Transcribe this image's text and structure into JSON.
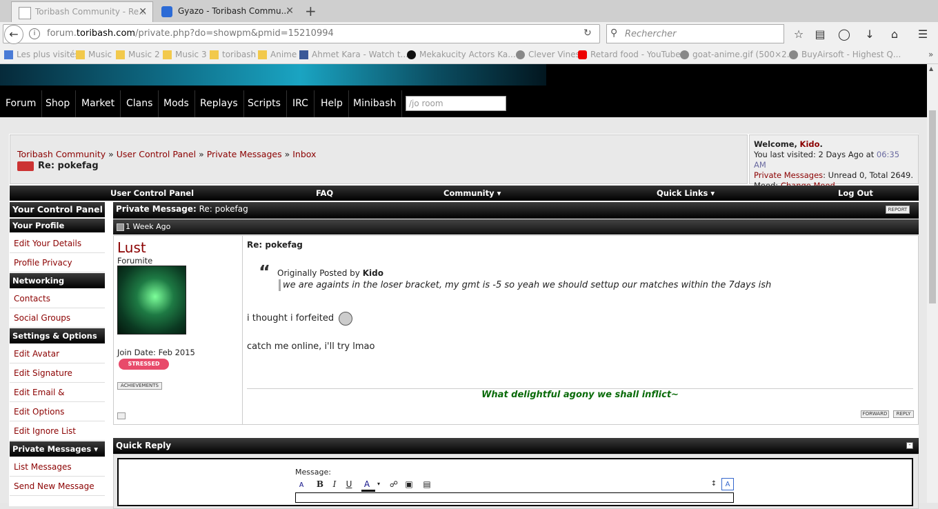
{
  "browser": {
    "tabs": [
      {
        "title": "Toribash Community - Re...",
        "active": true
      },
      {
        "title": "Gyazo - Toribash Commu...",
        "active": false
      }
    ],
    "new_tab": "+",
    "close_glyph": "✕",
    "url_prefix": "forum.",
    "url_domain": "toribash.com",
    "url_path": "/private.php?do=showpm&pmid=15210994",
    "search_placeholder": "Rechercher",
    "bookmarks": [
      "Les plus visités",
      "Music",
      "Music 2",
      "Music 3",
      "toribash",
      "Anime",
      "Ahmet Kara - Watch t...",
      "Mekakucity Actors Ka...",
      "Clever Vines",
      "Retard food - YouTube",
      "goat-anime.gif (500×2...",
      "BuyAirsoft - Highest Q..."
    ]
  },
  "topnav": {
    "items": [
      "Forum",
      "Shop",
      "Market",
      "Clans",
      "Mods",
      "Replays",
      "Scripts",
      "IRC",
      "Help",
      "Minibash"
    ],
    "room_placeholder": "/jo room"
  },
  "breadcrumb": {
    "items": [
      "Toribash Community",
      "User Control Panel",
      "Private Messages",
      "Inbox"
    ],
    "separator": "»",
    "current": "Re: pokefag"
  },
  "welcome": {
    "greeting": "Welcome,",
    "username": "Kido",
    "last_visited_label": "You last visited: 2 Days Ago at",
    "last_visited_time": "06:35 AM",
    "pm_label": "Private Messages",
    "pm_counts": ": Unread 0, Total 2649.",
    "mood_label": "Mood:",
    "mood_link": "Change Mood"
  },
  "ucpbar": {
    "ucp": "User Control Panel",
    "faq": "FAQ",
    "community": "Community",
    "quick_links": "Quick Links",
    "logout": "Log Out"
  },
  "sidebar": {
    "title": "Your Control Panel",
    "sections": [
      {
        "heading": "Your Profile",
        "items": [
          "Edit Your Details",
          "Profile Privacy"
        ]
      },
      {
        "heading": "Networking",
        "items": [
          "Contacts",
          "Social Groups"
        ]
      },
      {
        "heading": "Settings & Options",
        "items": [
          "Edit Avatar",
          "Edit Signature",
          "Edit Email & Password",
          "Edit Options",
          "Edit Ignore List"
        ]
      },
      {
        "heading": "Private Messages",
        "items": [
          "List Messages",
          "Send New Message"
        ]
      }
    ]
  },
  "pm": {
    "header_label": "Private Message:",
    "header_title": "Re: pokefag",
    "report": "REPORT",
    "date": "1 Week Ago",
    "author": "Lust",
    "author_title": "Forumite",
    "join_date": "Join Date: Feb 2015",
    "mood_badge": "STRESSED",
    "achievements": "ACHIEVEMENTS",
    "subject": "Re: pokefag",
    "quote_prefix": "Originally Posted by",
    "quote_author": "Kido",
    "quote_text": "we are againts in the loser bracket, my gmt is -5 so yeah we should settup our matches within the 7days ish",
    "line1": "i thought i forfeited",
    "line2": "catch me online, i'll try lmao",
    "signature": "What delightful agony we shall inflict~",
    "forward": "FORWARD",
    "reply": "REPLY"
  },
  "quick_reply": {
    "title": "Quick Reply",
    "message_label": "Message:"
  },
  "colors": {
    "link": "#8b0000",
    "signature": "#0a6b0a",
    "time": "#6a6aa0"
  }
}
